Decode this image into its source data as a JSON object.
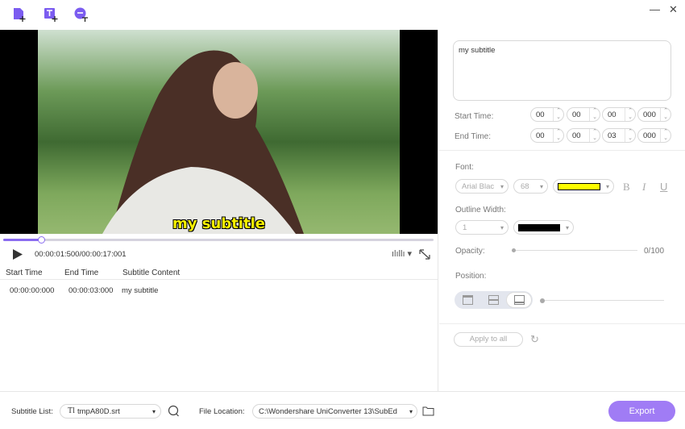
{
  "toolbar": {
    "icons": [
      "add-file-icon",
      "add-text-icon",
      "add-subtitle-icon"
    ],
    "accent": "#7b5cf0"
  },
  "window": {
    "minimize": "—",
    "close": "✕"
  },
  "video": {
    "subtitle_overlay": "my subtitle"
  },
  "player": {
    "time": "00:00:01:500/00:00:17:001",
    "progress_percent": 8.8
  },
  "table": {
    "headers": [
      "Start Time",
      "End Time",
      "Subtitle Content"
    ],
    "rows": [
      {
        "start": "00:00:00:000",
        "end": "00:00:03:000",
        "content": "my subtitle"
      }
    ]
  },
  "editor": {
    "text": "my subtitle",
    "start_label": "Start Time:",
    "end_label": "End Time:",
    "start": [
      "00",
      "00",
      "00",
      "000"
    ],
    "end": [
      "00",
      "00",
      "03",
      "000"
    ],
    "font_label": "Font:",
    "font": "Arial Blac",
    "size": "68",
    "font_color": "#ffff00",
    "bold": "B",
    "italic": "I",
    "underline": "U",
    "outline_label": "Outline Width:",
    "outline_width": "1",
    "outline_color": "#000000",
    "opacity_label": "Opacity:",
    "opacity": "0/100",
    "position_label": "Position:",
    "apply_all": "Apply to all"
  },
  "footer": {
    "subtitle_list_label": "Subtitle List:",
    "subtitle_file": "tmpA80D.srt",
    "file_location_label": "File Location:",
    "file_location": "C:\\Wondershare UniConverter 13\\SubEd",
    "export": "Export",
    "export_color": "#a07cf5"
  }
}
